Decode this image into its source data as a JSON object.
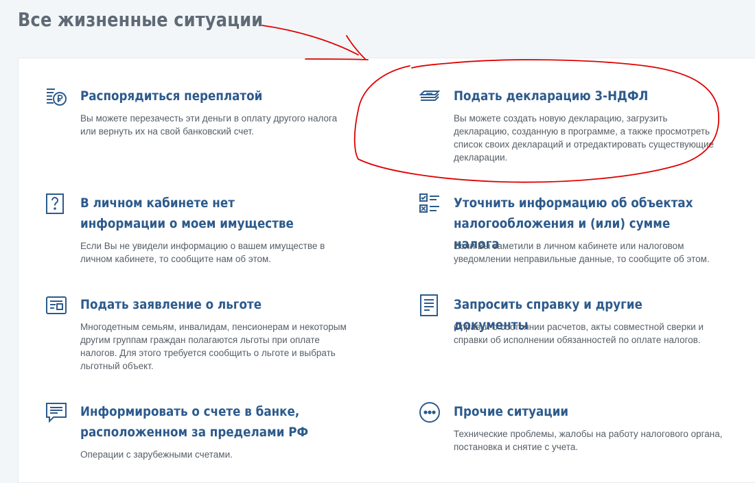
{
  "header": {
    "title": "Все жизненные ситуации"
  },
  "situations": [
    {
      "icon": "ruble-overpayment-icon",
      "title": "Распорядиться переплатой",
      "description": "Вы можете перезачесть эти деньги в оплату другого налога или вернуть их на свой банковский счет."
    },
    {
      "icon": "declaration-stack-icon",
      "title": "Подать декларацию 3-НДФЛ",
      "description": "Вы можете создать новую декларацию, загрузить декларацию, созданную в программе, а также просмотреть список своих деклараций и отредактировать существующие декларации."
    },
    {
      "icon": "question-icon",
      "title": "В личном кабинете нет информации о моем имуществе",
      "description": "Если Вы не увидели информацию о вашем имуществе в личном кабинете, то сообщите нам об этом."
    },
    {
      "icon": "checklist-icon",
      "title": "Уточнить информацию об объектах налогообложения и (или) сумме налога",
      "description": "Если Вы заметили в личном кабинете или налоговом уведомлении неправильные данные, то сообщите об этом."
    },
    {
      "icon": "benefit-card-icon",
      "title": "Подать заявление о льготе",
      "description": "Многодетным семьям, инвалидам, пенсионерам и некоторым другим группам граждан полагаются льготы при оплате налогов. Для этого требуется сообщить о льготе и выбрать льготный объект."
    },
    {
      "icon": "document-icon",
      "title": "Запросить справку и другие документы",
      "description": "Справки о состоянии расчетов, акты совместной сверки и справки об исполнении обязанностей по оплате налогов."
    },
    {
      "icon": "message-icon",
      "title": "Информировать о счете в банке, расположенном за пределами РФ",
      "description": "Операции с зарубежными счетами."
    },
    {
      "icon": "more-dots-icon",
      "title": "Прочие ситуации",
      "description": "Технические проблемы, жалобы на работу налогового органа, постановка и снятие с учета."
    }
  ],
  "colors": {
    "title": "#2c5a8c",
    "icon": "#2c5a8c",
    "text": "#555d66",
    "header": "#5f6a75",
    "annotation": "#e00000"
  }
}
